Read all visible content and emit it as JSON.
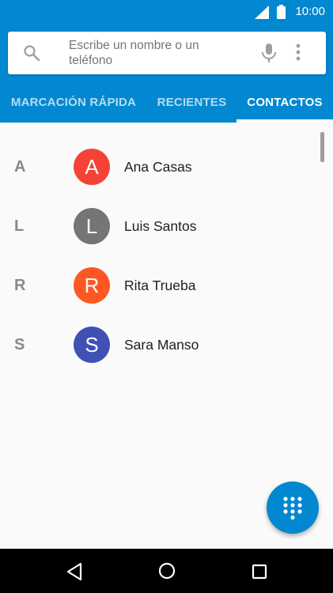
{
  "status_bar": {
    "time": "10:00",
    "icons": [
      "signal-icon",
      "battery-icon"
    ]
  },
  "search": {
    "placeholder": "Escribe un nombre o un teléfono",
    "icons": [
      "search-icon",
      "mic-icon",
      "more-icon"
    ]
  },
  "tabs": [
    {
      "label": "MARCACIÓN RÁPIDA",
      "active": false
    },
    {
      "label": "RECIENTES",
      "active": false
    },
    {
      "label": "CONTACTOS",
      "active": true
    }
  ],
  "contacts": [
    {
      "section": "A",
      "initial": "A",
      "name": "Ana Casas",
      "color": "#f44336"
    },
    {
      "section": "L",
      "initial": "L",
      "name": "Luis Santos",
      "color": "#757575"
    },
    {
      "section": "R",
      "initial": "R",
      "name": "Rita Trueba",
      "color": "#ff5722"
    },
    {
      "section": "S",
      "initial": "S",
      "name": "Sara Manso",
      "color": "#3f51b5"
    }
  ],
  "fab": {
    "icon": "dialpad-icon"
  },
  "nav_bar": {
    "icons": [
      "back-icon",
      "home-icon",
      "recents-icon"
    ]
  },
  "colors": {
    "primary": "#0288d1",
    "background": "#fafafa"
  }
}
